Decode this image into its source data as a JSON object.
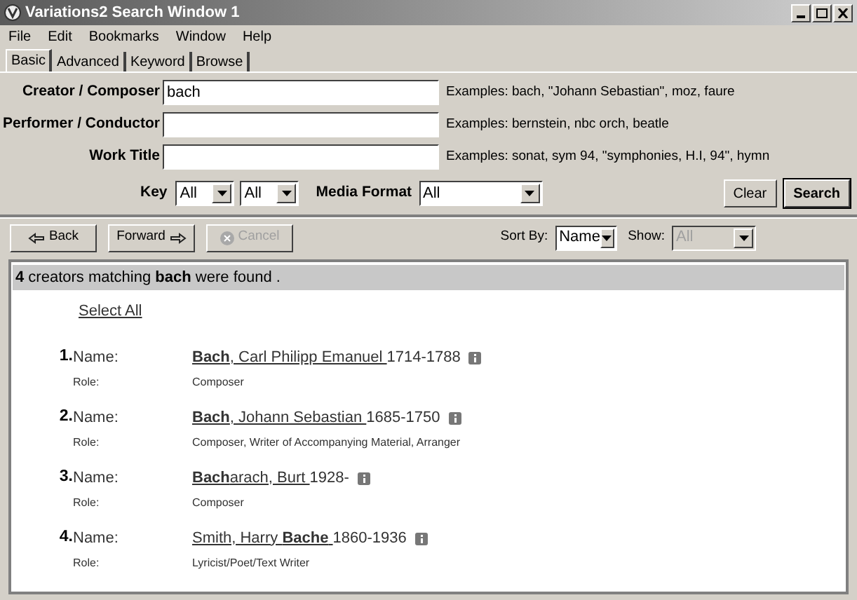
{
  "window": {
    "title": "Variations2 Search Window 1"
  },
  "menu": [
    "File",
    "Edit",
    "Bookmarks",
    "Window",
    "Help"
  ],
  "tabs": [
    {
      "label": "Basic",
      "selected": true
    },
    {
      "label": "Advanced",
      "selected": false
    },
    {
      "label": "Keyword",
      "selected": false
    },
    {
      "label": "Browse",
      "selected": false
    }
  ],
  "fields": [
    {
      "label": "Creator / Composer",
      "value": "bach",
      "hint": "Examples: bach, \"Johann Sebastian\", moz, faure"
    },
    {
      "label": "Performer / Conductor",
      "hint": "Examples: bernstein, nbc orch, beatle"
    },
    {
      "label": "Work Title",
      "hint": "Examples: sonat, sym 94, \"symphonies, H.I, 94\", hymn"
    }
  ],
  "key": {
    "label": "Key",
    "selects": [
      "All",
      "All"
    ]
  },
  "media_format": {
    "label": "Media Format",
    "value": "All"
  },
  "form_buttons": [
    "Clear",
    "Search"
  ],
  "nav_buttons": [
    {
      "label": "Back",
      "kind": "back",
      "disabled": false
    },
    {
      "label": "Forward",
      "kind": "forward",
      "disabled": false
    },
    {
      "label": "Cancel",
      "kind": "cancel",
      "disabled": true
    }
  ],
  "sort_by": {
    "label": "Sort By:",
    "value": "Name",
    "disabled": false
  },
  "show": {
    "label": "Show:",
    "value": "All",
    "disabled": true
  },
  "results": {
    "summary": "**4** creators matching **bach** were found .",
    "select_all": "Select All",
    "items": [
      {
        "number": "1.",
        "name_label": "Name:",
        "name": "**Bach**, Carl Philipp Emanuel ",
        "dates": "1714-1788",
        "role_label": "Role:",
        "role": "Composer"
      },
      {
        "number": "2.",
        "name_label": "Name:",
        "name": "**Bach**, Johann Sebastian ",
        "dates": "1685-1750",
        "role_label": "Role:",
        "role": "Composer, Writer of Accompanying Material, Arranger"
      },
      {
        "number": "3.",
        "name_label": "Name:",
        "name": "**Bach**arach, Burt ",
        "dates": "1928-",
        "role_label": "Role:",
        "role": "Composer"
      },
      {
        "number": "4.",
        "name_label": "Name:",
        "name": "Smith, Harry **Bache** ",
        "dates": "1860-1936",
        "role_label": "Role:",
        "role": "Lyricist/Poet/Text Writer"
      }
    ]
  }
}
